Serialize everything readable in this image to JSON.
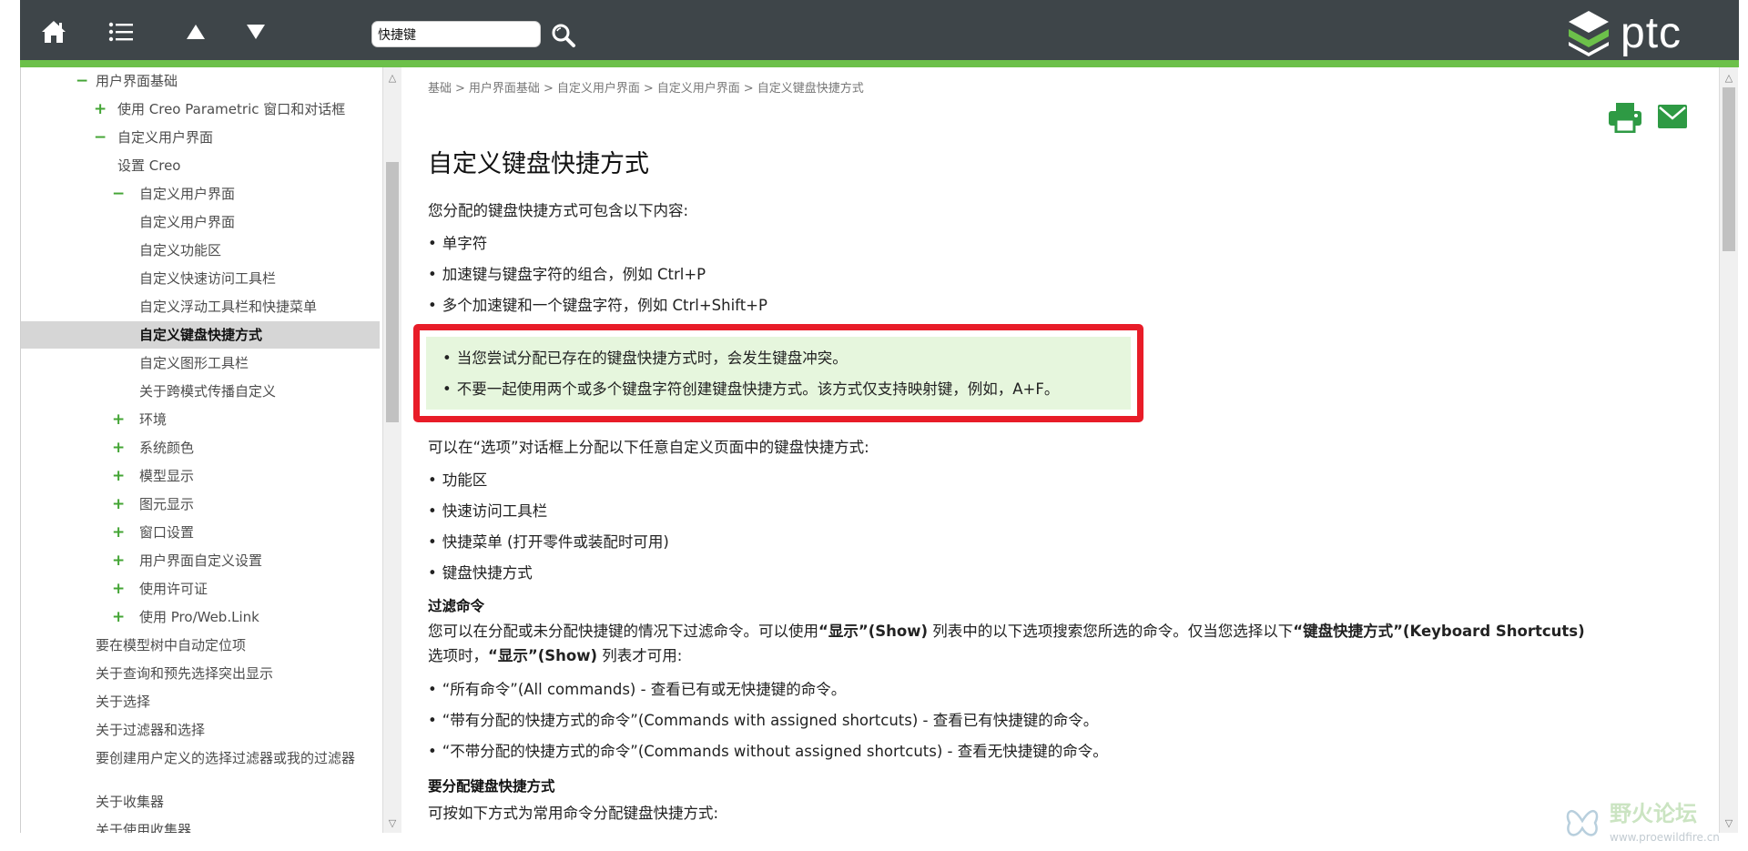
{
  "toolbar": {
    "home_icon": "home-icon",
    "toc_icon": "list-icon",
    "prev_icon": "triangle-up-icon",
    "next_icon": "triangle-down-icon",
    "search_value": "快捷键",
    "search_icon": "magnifier-icon"
  },
  "logo": {
    "text": "ptc"
  },
  "colors": {
    "topbar": "#3e4549",
    "accent_green": "#6cc04a",
    "highlight_red": "#e81c28",
    "note_bg": "#e6f6dd",
    "icon_green": "#2e9a44"
  },
  "nav": {
    "items": [
      {
        "sign": "−",
        "label": "用户界面基础"
      },
      {
        "sign": "+",
        "label": "使用 Creo Parametric 窗口和对话框"
      },
      {
        "sign": "−",
        "label": "自定义用户界面"
      },
      {
        "sign": "",
        "label": "设置 Creo"
      },
      {
        "sign": "−",
        "label": "自定义用户界面"
      },
      {
        "sign": "",
        "label": "自定义用户界面"
      },
      {
        "sign": "",
        "label": "自定义功能区"
      },
      {
        "sign": "",
        "label": "自定义快速访问工具栏"
      },
      {
        "sign": "",
        "label": "自定义浮动工具栏和快捷菜单"
      },
      {
        "sign": "",
        "label": "自定义键盘快捷方式"
      },
      {
        "sign": "",
        "label": "自定义图形工具栏"
      },
      {
        "sign": "",
        "label": "关于跨模式传播自定义"
      },
      {
        "sign": "+",
        "label": "环境"
      },
      {
        "sign": "+",
        "label": "系统颜色"
      },
      {
        "sign": "+",
        "label": "模型显示"
      },
      {
        "sign": "+",
        "label": "图元显示"
      },
      {
        "sign": "+",
        "label": "窗口设置"
      },
      {
        "sign": "+",
        "label": "用户界面自定义设置"
      },
      {
        "sign": "+",
        "label": "使用许可证"
      },
      {
        "sign": "+",
        "label": "使用 Pro/Web.Link"
      },
      {
        "sign": "",
        "label": "要在模型树中自动定位项"
      },
      {
        "sign": "",
        "label": "关于查询和预先选择突出显示"
      },
      {
        "sign": "",
        "label": "关于选择"
      },
      {
        "sign": "",
        "label": "关于过滤器和选择"
      },
      {
        "sign": "",
        "label": "要创建用户定义的选择过滤器或我的过滤器"
      },
      {
        "sign": "",
        "label": "关于收集器"
      },
      {
        "sign": "",
        "label": "关于使用收集器"
      }
    ]
  },
  "scrollbar": {
    "up_icon": "scroll-up-arrow-icon",
    "down_icon": "scroll-down-arrow-icon"
  },
  "breadcrumb": {
    "items": [
      "基础",
      "用户界面基础",
      "自定义用户界面",
      "自定义用户界面",
      "自定义键盘快捷方式"
    ],
    "separator": ">"
  },
  "actions": {
    "print_icon": "printer-icon",
    "email_icon": "envelope-icon"
  },
  "article": {
    "title": "自定义键盘快捷方式",
    "intro": "您分配的键盘快捷方式可包含以下内容:",
    "intro_list": [
      "单字符",
      "加速键与键盘字符的组合，例如 Ctrl+P",
      "多个加速键和一个键盘字符，例如 Ctrl+Shift+P"
    ],
    "note_list": [
      "当您尝试分配已存在的键盘快捷方式时，会发生键盘冲突。",
      "不要一起使用两个或多个键盘字符创建键盘快捷方式。该方式仅支持映射键，例如，A+F。"
    ],
    "options_intro": "可以在“选项”对话框上分配以下任意自定义页面中的键盘快捷方式:",
    "options_list": [
      "功能区",
      "快速访问工具栏",
      "快捷菜单 (打开零件或装配时可用)",
      "键盘快捷方式"
    ],
    "filter_heading": "过滤命令",
    "filter_text_1": "您可以在分配或未分配快捷键的情况下过滤命令。可以使用",
    "filter_bold_1": "“显示”(Show)",
    "filter_text_2": " 列表中的以下选项搜索您所选的命令。仅当您选择以下",
    "filter_bold_2": "“键盘快捷方式”(Keyboard Shortcuts)",
    "filter_text_3": "选项时，",
    "filter_bold_3": "“显示”(Show)",
    "filter_text_4": " 列表才可用:",
    "filter_list": [
      "“所有命令”(All commands) - 查看已有或无快捷键的命令。",
      "“带有分配的快捷方式的命令”(Commands with assigned shortcuts) - 查看已有快捷键的命令。",
      "“不带分配的快捷方式的命令”(Commands without assigned shortcuts) - 查看无快捷键的命令。"
    ],
    "assign_heading": "要分配键盘快捷方式",
    "assign_intro": "可按如下方式为常用命令分配键盘快捷方式:"
  },
  "watermark": {
    "title": "野火论坛",
    "url": "www.proewildfire.cn"
  }
}
